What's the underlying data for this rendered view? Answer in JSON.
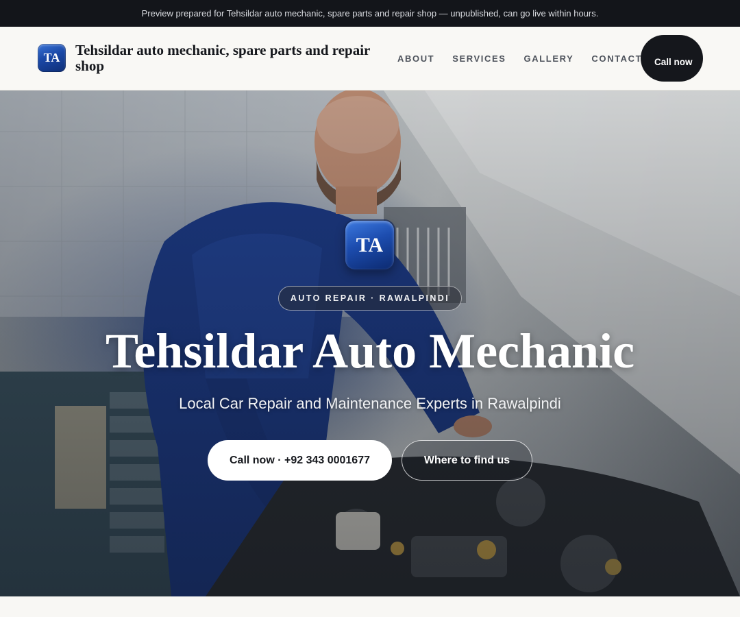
{
  "preview_banner": {
    "text": "Preview prepared for Tehsildar auto mechanic, spare parts and repair shop — unpublished, can go live within hours."
  },
  "header": {
    "logo_initials": "TA",
    "business_name": "Tehsildar auto mechanic, spare parts and repair shop",
    "nav": [
      "ABOUT",
      "SERVICES",
      "GALLERY",
      "CONTACT"
    ],
    "cta_label": "Call now"
  },
  "hero": {
    "logo_initials": "TA",
    "badge": "AUTO REPAIR · RAWALPINDI",
    "title": "Tehsildar Auto Mechanic",
    "subtitle": "Local Car Repair and Maintenance Experts in Rawalpindi",
    "primary_button": "Call now · +92 343 0001677",
    "secondary_button": "Where to find us"
  },
  "colors": {
    "banner_bg": "#13151a",
    "header_bg": "#f9f8f5",
    "cta_bg": "#15171c",
    "logo_blue": "#1c4cae"
  }
}
